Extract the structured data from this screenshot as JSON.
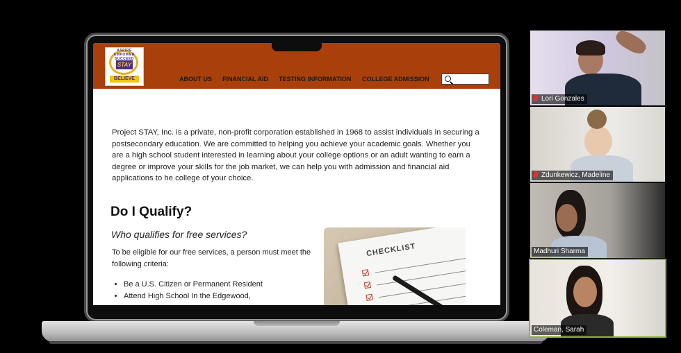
{
  "website": {
    "logo": {
      "arc_text": "ASPIRE EMPOWER SUCCEED",
      "center_text": "STAY",
      "ribbon_text": "BELIEVE"
    },
    "nav": [
      {
        "label": "ABOUT US"
      },
      {
        "label": "FINANCIAL AID"
      },
      {
        "label": "TESTING INFORMATION"
      },
      {
        "label": "COLLEGE ADMISSION"
      }
    ],
    "search": {
      "placeholder": ""
    },
    "intro": "Project STAY, Inc. is a private, non-profit corporation established in 1968 to assist individuals in securing a postsecondary education. We are committed to helping you achieve your academic goals. Whether you are a high school student interested in learning about your college options or an adult wanting to earn a degree or improve your skills for the job market, we can help you with admission and financial aid applications to he college of your choice.",
    "qualify_heading": "Do I Qualify?",
    "qualify_subheading": "Who qualifies for free services?",
    "eligibility_text": "To be eligible for our free services, a person must meet the following criteria:",
    "criteria": [
      "Be a U.S. Citizen or Permanent Resident",
      "Attend High School In the Edgewood,"
    ],
    "image_text": "CHECKLIST"
  },
  "participants": [
    {
      "name": "Lori Gonzales",
      "muted": true
    },
    {
      "name": "Zdunkewicz, Madeline",
      "muted": true
    },
    {
      "name": "Madhuri Sharma",
      "muted": false
    },
    {
      "name": "Coleman, Sarah",
      "muted": false,
      "active_speaker": true
    }
  ],
  "colors": {
    "header": "#a9400c",
    "active_speaker_border": "#8fb339",
    "mute_icon": "#e03131"
  }
}
